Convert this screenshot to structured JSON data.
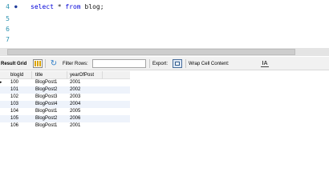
{
  "editor": {
    "lines": [
      {
        "num": "4",
        "marker": "●",
        "keyword1": "select",
        "text1": " * ",
        "keyword2": "from",
        "text2": " blog;"
      },
      {
        "num": "5"
      },
      {
        "num": "6"
      },
      {
        "num": "7"
      }
    ]
  },
  "toolbar": {
    "result_grid_label": "Result Grid",
    "filter_rows_label": "Filter Rows:",
    "filter_value": "",
    "export_label": "Export:",
    "wrap_label": "Wrap Cell Content:",
    "wrap_icon_text": "IA"
  },
  "grid": {
    "columns": [
      "blogId",
      "title",
      "yearOfPost"
    ],
    "rows": [
      [
        "100",
        "BlogPost1",
        "2001"
      ],
      [
        "101",
        "BlogPost2",
        "2002"
      ],
      [
        "102",
        "BlogPost3",
        "2003"
      ],
      [
        "103",
        "BlogPost4",
        "2004"
      ],
      [
        "104",
        "BlogPost1",
        "2005"
      ],
      [
        "105",
        "BlogPost2",
        "2006"
      ],
      [
        "106",
        "BlogPost1",
        "2001"
      ]
    ],
    "current_row_marker": "▸"
  }
}
